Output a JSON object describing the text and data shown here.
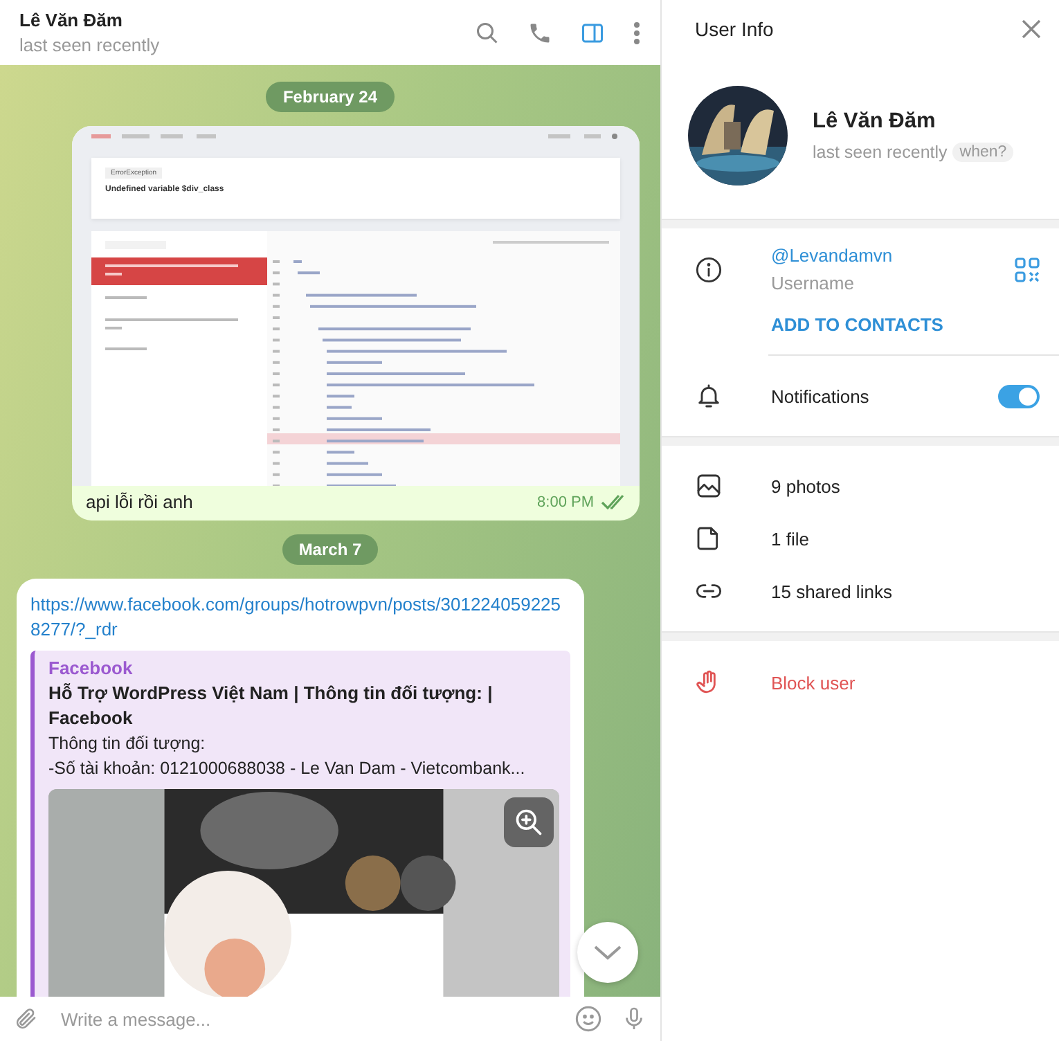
{
  "chat": {
    "header": {
      "name": "Lê Văn Đăm",
      "status": "last seen recently"
    },
    "messages": [
      {
        "kind": "date",
        "text": "February 24"
      },
      {
        "kind": "screenshot",
        "caption": "api lỗi rồi anh",
        "time": "8:00 PM",
        "read": true,
        "shot": {
          "exception": "ErrorException",
          "message": "Undefined variable $div_class"
        }
      },
      {
        "kind": "date",
        "text": "March 7"
      },
      {
        "kind": "link",
        "url": "https://www.facebook.com/groups/hotrowpvn/posts/3012240592258277/?_rdr",
        "preview": {
          "site": "Facebook",
          "title": "Hỗ Trợ WordPress Việt Nam | Thông tin đối tượng: | Facebook",
          "lines": [
            "Thông tin đối tượng:",
            "-Số tài khoản: 0121000688038 - Le Van Dam - Vietcombank..."
          ]
        }
      }
    ],
    "composer": {
      "placeholder": "Write a message..."
    }
  },
  "user_info": {
    "title": "User Info",
    "name": "Lê Văn Đăm",
    "status": "last seen recently",
    "when": "when?",
    "username": "@Levandamvn",
    "username_label": "Username",
    "add_contact": "ADD TO CONTACTS",
    "notifications": {
      "label": "Notifications",
      "on": true
    },
    "media": [
      {
        "kind": "photos",
        "label": "9 photos"
      },
      {
        "kind": "files",
        "label": "1 file"
      },
      {
        "kind": "links",
        "label": "15 shared links"
      }
    ],
    "block": "Block user"
  }
}
